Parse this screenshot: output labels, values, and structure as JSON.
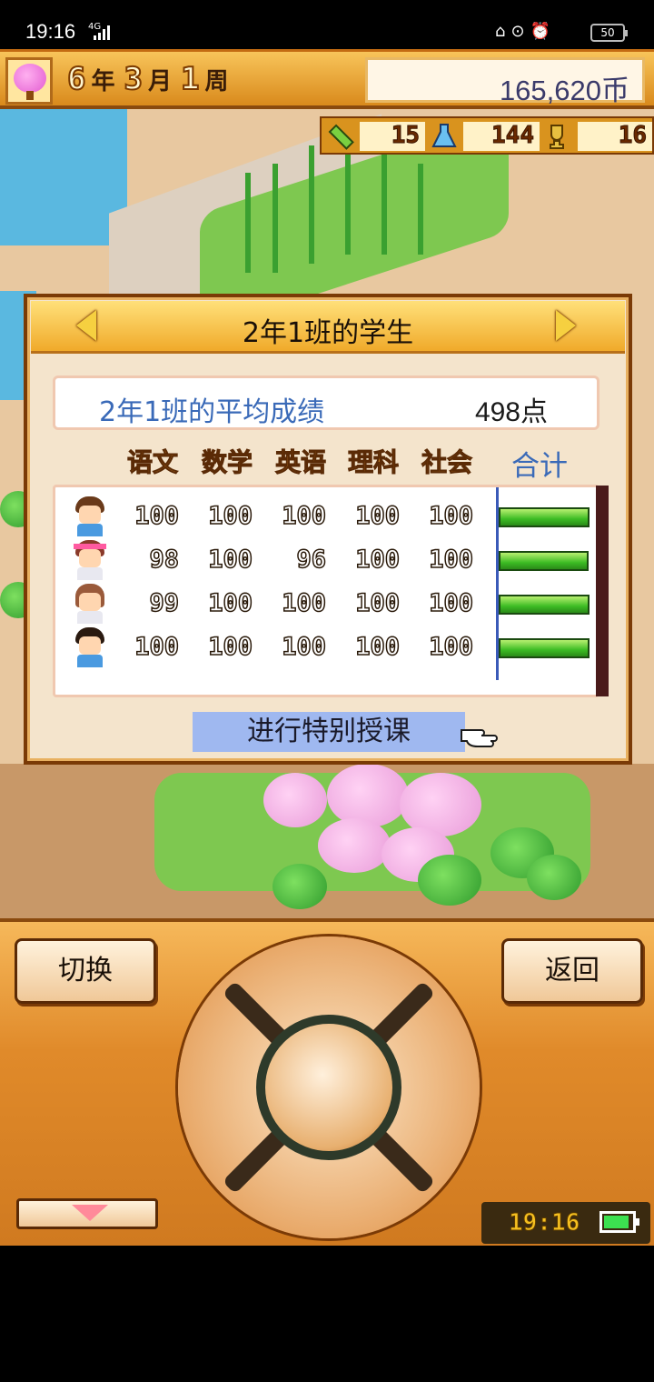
{
  "status_bar": {
    "time": "19:16",
    "network": "4G",
    "battery": "50"
  },
  "top_bar": {
    "date": {
      "year": "6",
      "year_unit": "年",
      "month": "3",
      "month_unit": "月",
      "week": "1",
      "week_unit": "周"
    },
    "money": "165,620币"
  },
  "resources": {
    "first": {
      "icon": "pencil-icon",
      "value": "15"
    },
    "second": {
      "icon": "flask-icon",
      "value": "144"
    },
    "third": {
      "icon": "trophy-icon",
      "value": "16"
    }
  },
  "dialog": {
    "title": "2年1班的学生",
    "average_label": "2年1班的平均成绩",
    "average_value": "498点",
    "subjects": [
      "语文",
      "数学",
      "英语",
      "理科",
      "社会"
    ],
    "total_label": "合计",
    "students": [
      {
        "scores": [
          "100",
          "100",
          "100",
          "100",
          "100"
        ],
        "total": 500
      },
      {
        "scores": [
          "98",
          "100",
          "96",
          "100",
          "100"
        ],
        "total": 494
      },
      {
        "scores": [
          "99",
          "100",
          "100",
          "100",
          "100"
        ],
        "total": 499
      },
      {
        "scores": [
          "100",
          "100",
          "100",
          "100",
          "100"
        ],
        "total": 500
      }
    ],
    "special_button": "进行特别授课"
  },
  "controller": {
    "switch_label": "切换",
    "back_label": "返回",
    "clock": "19:16",
    "battery_level": 0.9
  },
  "colors": {
    "accent_orange": "#e08a2a",
    "label_blue": "#3a6ab8",
    "bar_green": "#3cbc24"
  }
}
